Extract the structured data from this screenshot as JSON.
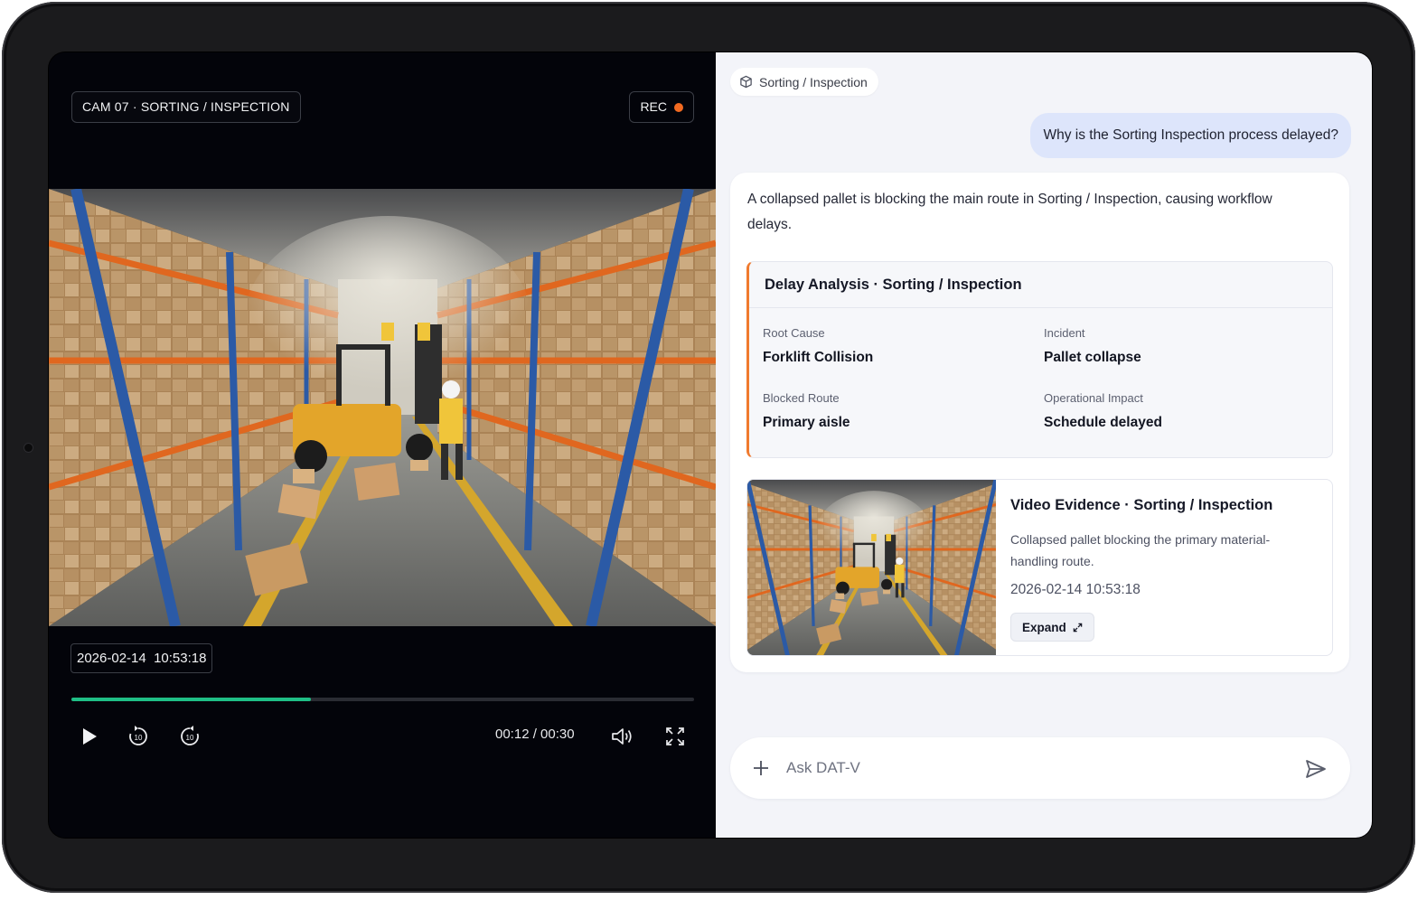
{
  "video": {
    "camera_label": "CAM 07 · SORTING / INSPECTION",
    "rec_label": "REC",
    "timestamp": "2026-02-14  10:53:18",
    "progress": 0.385,
    "time_readout": "00:12 / 00:30"
  },
  "chat": {
    "context_chip": "Sorting / Inspection",
    "user_message": "Why is the Sorting Inspection process delayed?",
    "answer": "A collapsed pallet is blocking the main route in Sorting / Inspection, causing workflow delays.",
    "delay_card": {
      "title": "Delay Analysis · Sorting / Inspection",
      "fields": [
        {
          "label": "Root Cause",
          "value": "Forklift Collision"
        },
        {
          "label": "Incident",
          "value": "Pallet collapse"
        },
        {
          "label": "Blocked Route",
          "value": "Primary aisle"
        },
        {
          "label": "Operational Impact",
          "value": "Schedule delayed"
        }
      ]
    },
    "evidence_card": {
      "title": "Video Evidence · Sorting / Inspection",
      "description": "Collapsed pallet blocking the primary material-handling route.",
      "timestamp": "2026-02-14 10:53:18",
      "expand_label": "Expand"
    },
    "input": {
      "placeholder": "Ask DAT-V"
    }
  },
  "colors": {
    "accent_orange": "#f07a2e",
    "progress_green": "#1fbf86",
    "rec_dot": "#f26a21",
    "user_bubble": "#dde5fb"
  },
  "icons": [
    "play-icon",
    "rewind-10-icon",
    "forward-10-icon",
    "volume-icon",
    "fullscreen-icon",
    "cube-icon",
    "expand-icon",
    "plus-icon",
    "send-icon"
  ]
}
